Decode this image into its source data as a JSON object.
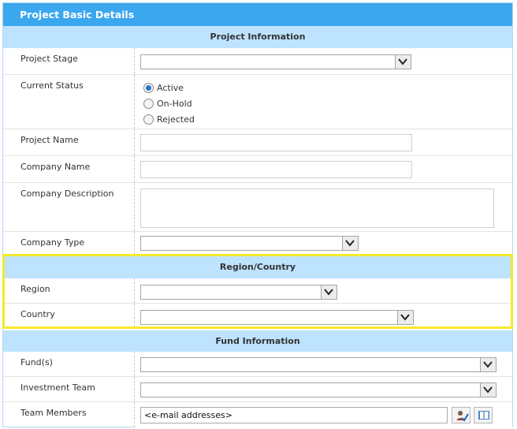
{
  "header": {
    "title": "Project Basic Details"
  },
  "sections": {
    "project_information": "Project Information",
    "region_country": "Region/Country",
    "fund_information": "Fund Information"
  },
  "fields": {
    "project_stage": {
      "label": "Project Stage",
      "value": ""
    },
    "current_status": {
      "label": "Current Status",
      "options": [
        "Active",
        "On-Hold",
        "Rejected"
      ],
      "selected": "Active"
    },
    "project_name": {
      "label": "Project Name",
      "value": ""
    },
    "company_name": {
      "label": "Company Name",
      "value": ""
    },
    "company_description": {
      "label": "Company Description",
      "value": ""
    },
    "company_type": {
      "label": "Company Type",
      "value": ""
    },
    "region": {
      "label": "Region",
      "value": ""
    },
    "country": {
      "label": "Country",
      "value": ""
    },
    "funds": {
      "label": "Fund(s)",
      "value": ""
    },
    "investment_team": {
      "label": "Investment Team",
      "value": ""
    },
    "team_members": {
      "label": "Team Members",
      "value": "<e-mail addresses>"
    }
  },
  "icons": {
    "check_names": "check-names-icon",
    "address_book": "address-book-icon"
  },
  "colors": {
    "header_bg": "#3aa7ef",
    "section_bg": "#bee3ff",
    "highlight_border": "#f5ea2b",
    "radio_selected": "#2a72c9"
  }
}
